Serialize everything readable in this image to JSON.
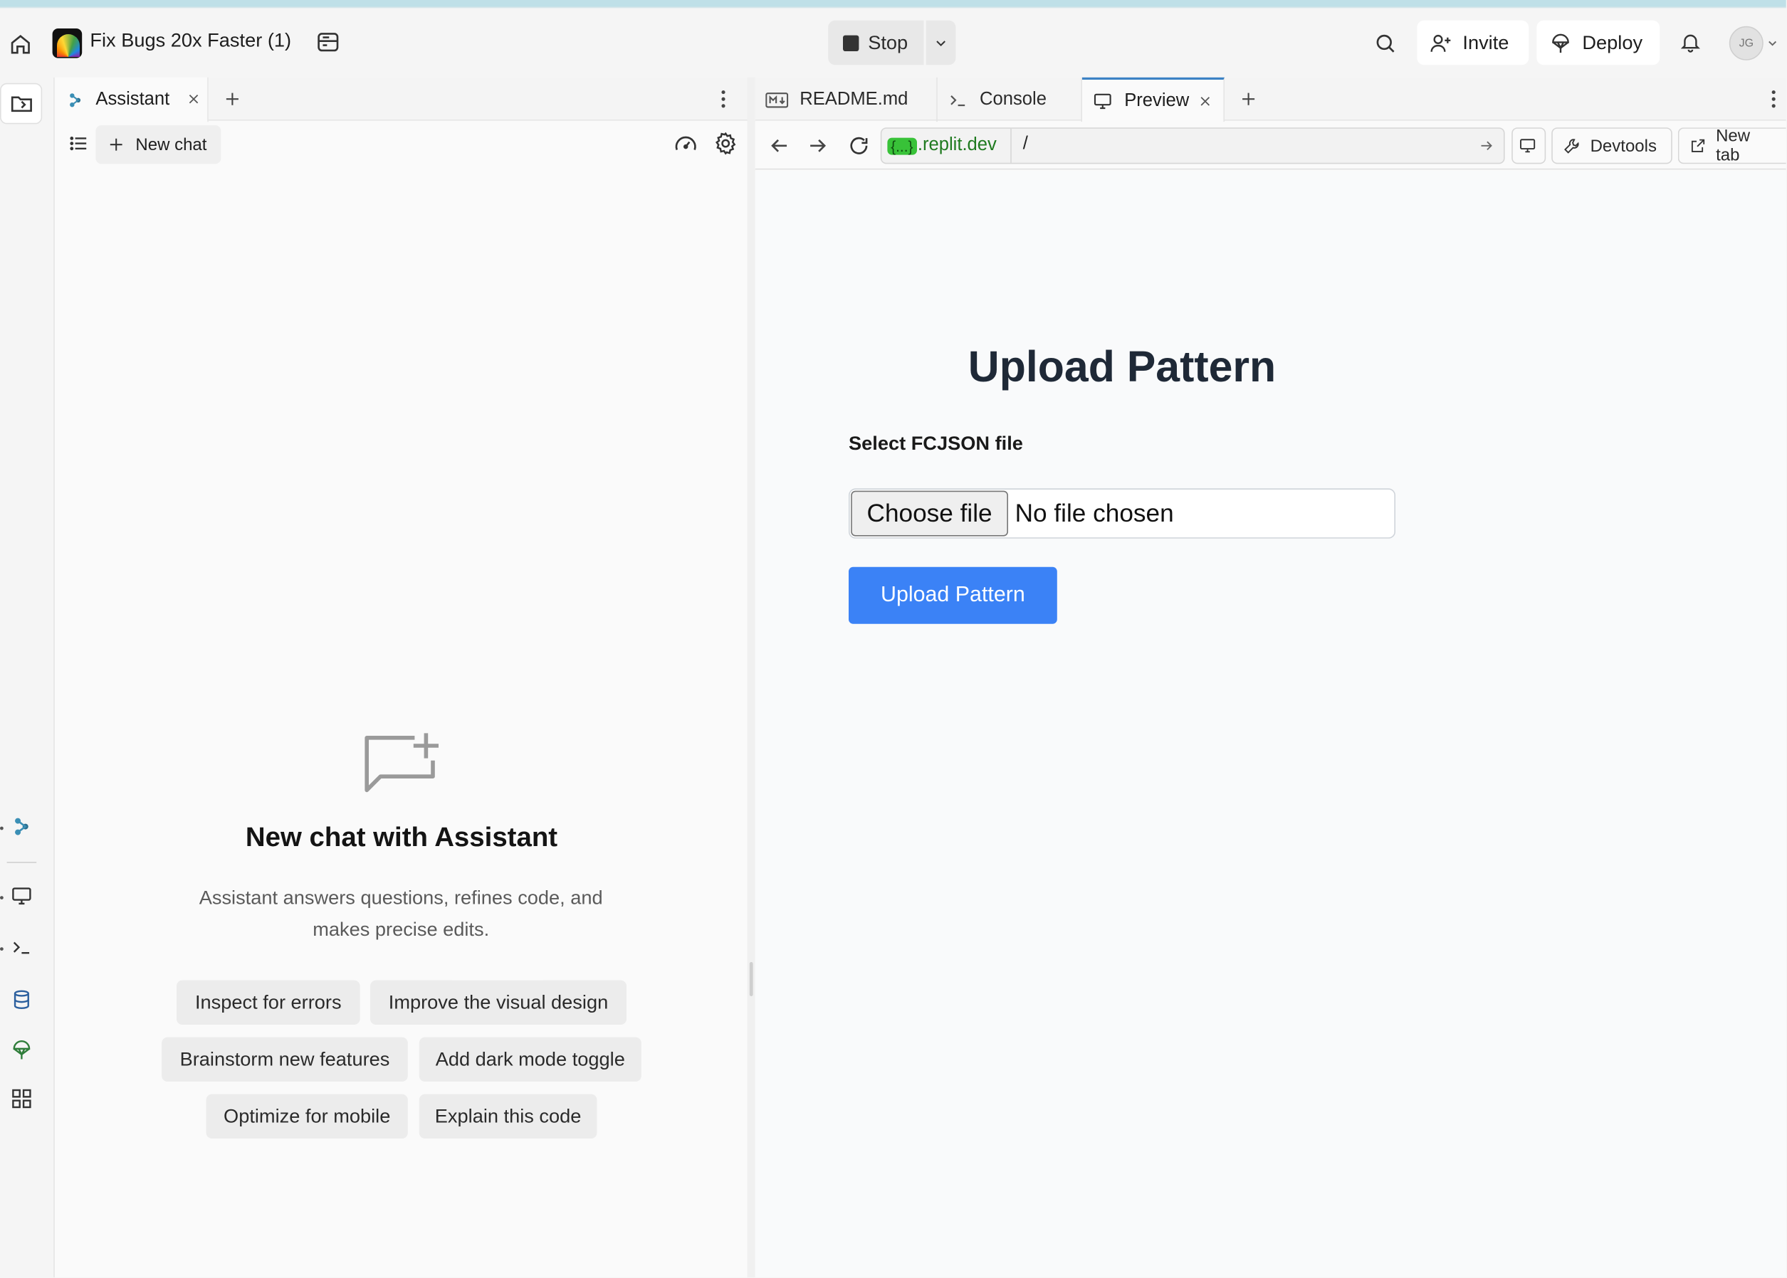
{
  "window": {
    "project_title": "Fix Bugs 20x Faster (1)",
    "stop_label": "Stop",
    "invite_label": "Invite",
    "deploy_label": "Deploy",
    "avatar_initials": "JG"
  },
  "assistant": {
    "tab_label": "Assistant",
    "new_chat_label": "New chat",
    "empty_title": "New chat with Assistant",
    "empty_description": "Assistant answers questions, refines code, and makes precise edits.",
    "suggestions": [
      "Inspect for errors",
      "Improve the visual design",
      "Brainstorm new features",
      "Add dark mode toggle",
      "Optimize for mobile",
      "Explain this code"
    ]
  },
  "right_tabs": {
    "readme": "README.md",
    "console": "Console",
    "preview": "Preview"
  },
  "urlbar": {
    "host_chip": "{...}",
    "host_domain": ".replit.dev",
    "path": "/",
    "devtools_label": "Devtools",
    "new_tab_label": "New tab"
  },
  "preview_page": {
    "title": "Upload Pattern",
    "file_label": "Select FCJSON file",
    "choose_file": "Choose file",
    "no_file": "No file chosen",
    "upload_button": "Upload Pattern"
  },
  "colors": {
    "accent_blue": "#3b82f6",
    "active_tab_border": "#3b82c4",
    "url_host_green": "#1f7a1f"
  }
}
